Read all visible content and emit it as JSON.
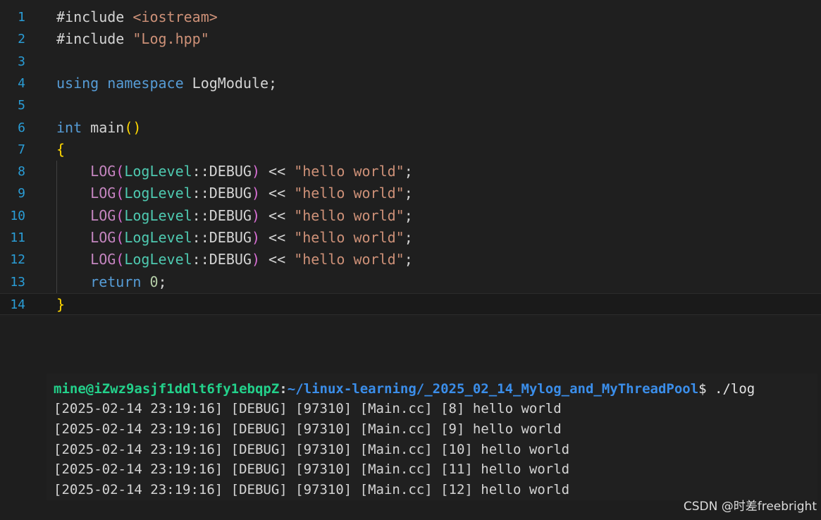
{
  "editor": {
    "line_numbers": [
      "1",
      "2",
      "3",
      "4",
      "5",
      "6",
      "7",
      "8",
      "9",
      "10",
      "11",
      "12",
      "13",
      "14"
    ],
    "lines": [
      {
        "tokens": [
          {
            "cls": "id",
            "text": "#include "
          },
          {
            "cls": "str",
            "text": "<iostream>"
          }
        ]
      },
      {
        "tokens": [
          {
            "cls": "id",
            "text": "#include "
          },
          {
            "cls": "str",
            "text": "\"Log.hpp\""
          }
        ]
      },
      {
        "tokens": []
      },
      {
        "tokens": [
          {
            "cls": "kw",
            "text": "using"
          },
          {
            "cls": "id",
            "text": " "
          },
          {
            "cls": "kw",
            "text": "namespace"
          },
          {
            "cls": "id",
            "text": " LogModule;"
          }
        ]
      },
      {
        "tokens": []
      },
      {
        "tokens": [
          {
            "cls": "kw",
            "text": "int"
          },
          {
            "cls": "id",
            "text": " main"
          },
          {
            "cls": "brace",
            "text": "()"
          }
        ]
      },
      {
        "tokens": [
          {
            "cls": "brace",
            "text": "{"
          }
        ]
      },
      {
        "tokens": [
          {
            "cls": "id",
            "text": "    "
          },
          {
            "cls": "macro",
            "text": "LOG"
          },
          {
            "cls": "paren2",
            "text": "("
          },
          {
            "cls": "ns2",
            "text": "LogLevel"
          },
          {
            "cls": "id",
            "text": "::DEBUG"
          },
          {
            "cls": "paren2",
            "text": ")"
          },
          {
            "cls": "op",
            "text": " << "
          },
          {
            "cls": "str",
            "text": "\"hello world\""
          },
          {
            "cls": "id",
            "text": ";"
          }
        ]
      },
      {
        "tokens": [
          {
            "cls": "id",
            "text": "    "
          },
          {
            "cls": "macro",
            "text": "LOG"
          },
          {
            "cls": "paren2",
            "text": "("
          },
          {
            "cls": "ns2",
            "text": "LogLevel"
          },
          {
            "cls": "id",
            "text": "::DEBUG"
          },
          {
            "cls": "paren2",
            "text": ")"
          },
          {
            "cls": "op",
            "text": " << "
          },
          {
            "cls": "str",
            "text": "\"hello world\""
          },
          {
            "cls": "id",
            "text": ";"
          }
        ]
      },
      {
        "tokens": [
          {
            "cls": "id",
            "text": "    "
          },
          {
            "cls": "macro",
            "text": "LOG"
          },
          {
            "cls": "paren2",
            "text": "("
          },
          {
            "cls": "ns2",
            "text": "LogLevel"
          },
          {
            "cls": "id",
            "text": "::DEBUG"
          },
          {
            "cls": "paren2",
            "text": ")"
          },
          {
            "cls": "op",
            "text": " << "
          },
          {
            "cls": "str",
            "text": "\"hello world\""
          },
          {
            "cls": "id",
            "text": ";"
          }
        ]
      },
      {
        "tokens": [
          {
            "cls": "id",
            "text": "    "
          },
          {
            "cls": "macro",
            "text": "LOG"
          },
          {
            "cls": "paren2",
            "text": "("
          },
          {
            "cls": "ns2",
            "text": "LogLevel"
          },
          {
            "cls": "id",
            "text": "::DEBUG"
          },
          {
            "cls": "paren2",
            "text": ")"
          },
          {
            "cls": "op",
            "text": " << "
          },
          {
            "cls": "str",
            "text": "\"hello world\""
          },
          {
            "cls": "id",
            "text": ";"
          }
        ]
      },
      {
        "tokens": [
          {
            "cls": "id",
            "text": "    "
          },
          {
            "cls": "macro",
            "text": "LOG"
          },
          {
            "cls": "paren2",
            "text": "("
          },
          {
            "cls": "ns2",
            "text": "LogLevel"
          },
          {
            "cls": "id",
            "text": "::DEBUG"
          },
          {
            "cls": "paren2",
            "text": ")"
          },
          {
            "cls": "op",
            "text": " << "
          },
          {
            "cls": "str",
            "text": "\"hello world\""
          },
          {
            "cls": "id",
            "text": ";"
          }
        ]
      },
      {
        "tokens": [
          {
            "cls": "id",
            "text": "    "
          },
          {
            "cls": "kw",
            "text": "return"
          },
          {
            "cls": "id",
            "text": " "
          },
          {
            "cls": "num",
            "text": "0"
          },
          {
            "cls": "id",
            "text": ";"
          }
        ]
      },
      {
        "tokens": [
          {
            "cls": "brace",
            "text": "}"
          }
        ]
      }
    ]
  },
  "terminal": {
    "prompt": {
      "user_host": "mine@iZwz9asjf1ddlt6fy1ebqpZ",
      "separator": ":",
      "path": "~/linux-learning/_2025_02_14_Mylog_and_MyThreadPool",
      "symbol": "$",
      "command": " ./log"
    },
    "output": [
      "[2025-02-14 23:19:16] [DEBUG] [97310] [Main.cc] [8] hello world",
      "[2025-02-14 23:19:16] [DEBUG] [97310] [Main.cc] [9] hello world",
      "[2025-02-14 23:19:16] [DEBUG] [97310] [Main.cc] [10] hello world",
      "[2025-02-14 23:19:16] [DEBUG] [97310] [Main.cc] [11] hello world",
      "[2025-02-14 23:19:16] [DEBUG] [97310] [Main.cc] [12] hello world"
    ]
  },
  "watermark": "CSDN @时差freebright",
  "colors": {
    "editor_bg": "#1f1f1f",
    "line_number": "#2a9dd6",
    "keyword": "#569cd6",
    "string": "#ce9178",
    "macro": "#c586c0",
    "type": "#4ec9b0",
    "brace": "#ffd700",
    "terminal_bg": "#202020",
    "prompt_user": "#23d18b",
    "prompt_path": "#3b8eea"
  }
}
